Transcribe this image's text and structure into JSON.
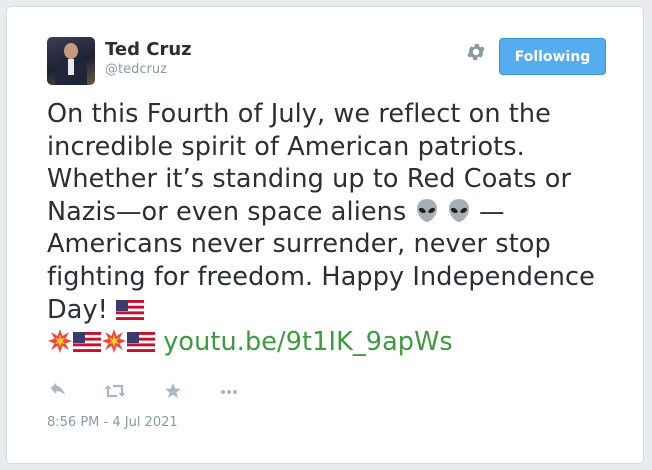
{
  "user": {
    "name": "Ted Cruz",
    "handle": "@tedcruz"
  },
  "follow_button": {
    "label": "Following"
  },
  "tweet": {
    "text_part1": "On this Fourth of July, we reflect on the incredible spirit of American patriots. Whether it’s standing up to Red Coats or Nazis—or even space aliens",
    "text_part2": "—Americans never surrender, never stop fighting for freedom. Happy Independence Day!",
    "link": "youtu.be/9t1IK_9apWs"
  },
  "timestamp": "8:56 PM - 4 Jul 2021",
  "colors": {
    "accent": "#55acee",
    "link": "#3d9a3f",
    "text": "#292f33",
    "muted": "#8899a6"
  },
  "icons": [
    "gear-icon",
    "reply-icon",
    "retweet-icon",
    "favorite-icon",
    "more-icon",
    "alien-emoji",
    "us-flag-emoji",
    "collision-emoji"
  ]
}
